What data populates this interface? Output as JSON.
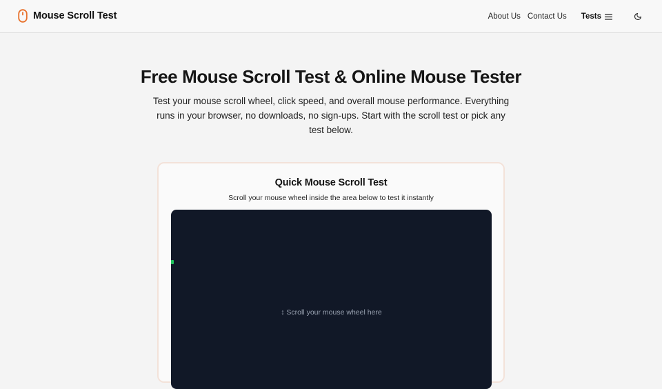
{
  "header": {
    "brand_title": "Mouse Scroll Test",
    "brand_icon": "mouse-icon",
    "accent_color": "#e8702a",
    "nav": {
      "about": "About Us",
      "contact": "Contact Us",
      "tests": "Tests",
      "tests_icon": "menu-icon",
      "theme_icon": "moon-icon"
    }
  },
  "hero": {
    "title": "Free Mouse Scroll Test & Online Mouse Tester",
    "description": "Test your mouse scroll wheel, click speed, and overall mouse performance. Everything runs in your browser, no downloads, no sign-ups. Start with the scroll test or pick any test below."
  },
  "quick_test": {
    "title": "Quick Mouse Scroll Test",
    "subtitle": "Scroll your mouse wheel inside the area below to test it instantly",
    "hint": "↕ Scroll your mouse wheel here",
    "area_color": "#111827",
    "indicator_color": "#22c55e"
  }
}
